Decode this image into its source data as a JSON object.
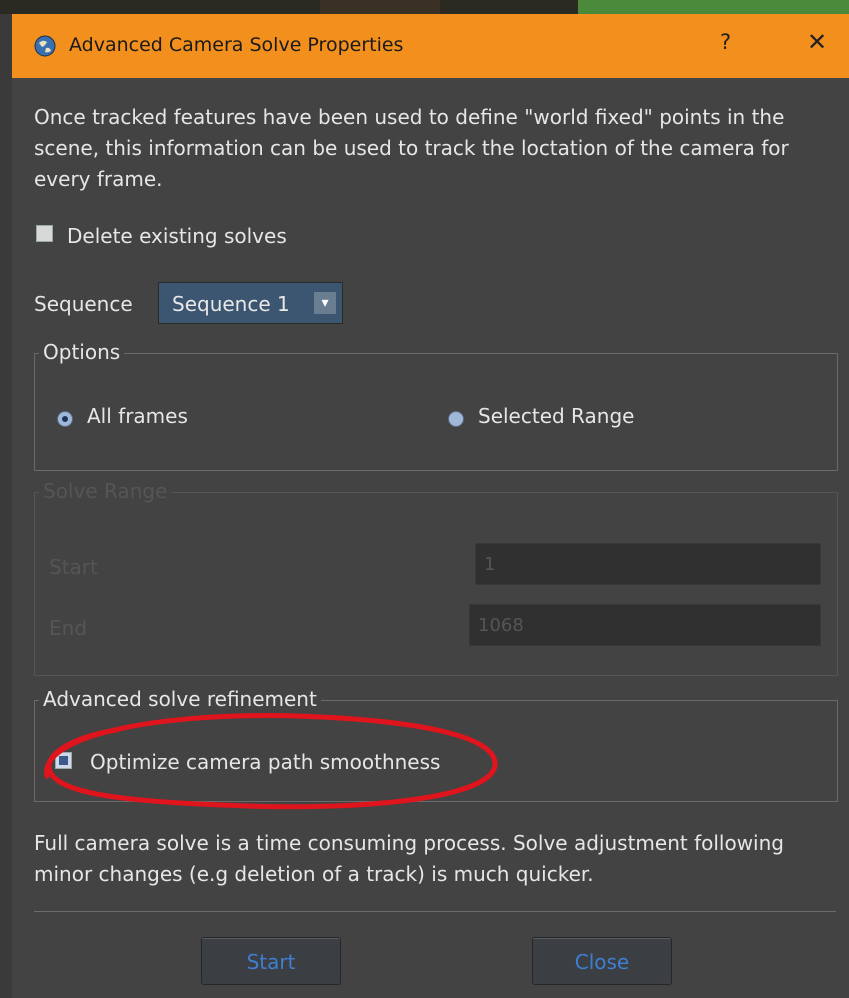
{
  "dialog": {
    "title": "Advanced Camera Solve Properties",
    "help_label": "?",
    "close_label": "✕"
  },
  "description": "Once tracked features have been used to define \"world fixed\" points in the scene, this information can be used to track the loctation of the camera for every frame.",
  "delete_solves": {
    "label": "Delete existing solves",
    "checked": false
  },
  "sequence": {
    "label": "Sequence",
    "value": "Sequence 1",
    "arrow": "▾"
  },
  "options": {
    "legend": "Options",
    "all_frames": "All frames",
    "selected_range": "Selected Range",
    "selected": "all_frames"
  },
  "solve_range": {
    "legend": "Solve Range",
    "start_label": "Start",
    "start_value": "1",
    "end_label": "End",
    "end_value": "1068"
  },
  "refinement": {
    "legend": "Advanced solve refinement",
    "optimize_label": "Optimize camera path smoothness",
    "optimize_checked": true
  },
  "footer_text": "Full camera solve is a time consuming process. Solve adjustment following minor changes (e.g deletion of a track) is much quicker.",
  "buttons": {
    "start": "Start",
    "close": "Close"
  },
  "colors": {
    "titlebar": "#f3901d",
    "annotation": "#e0141c",
    "button_text": "#3f7fd0"
  }
}
